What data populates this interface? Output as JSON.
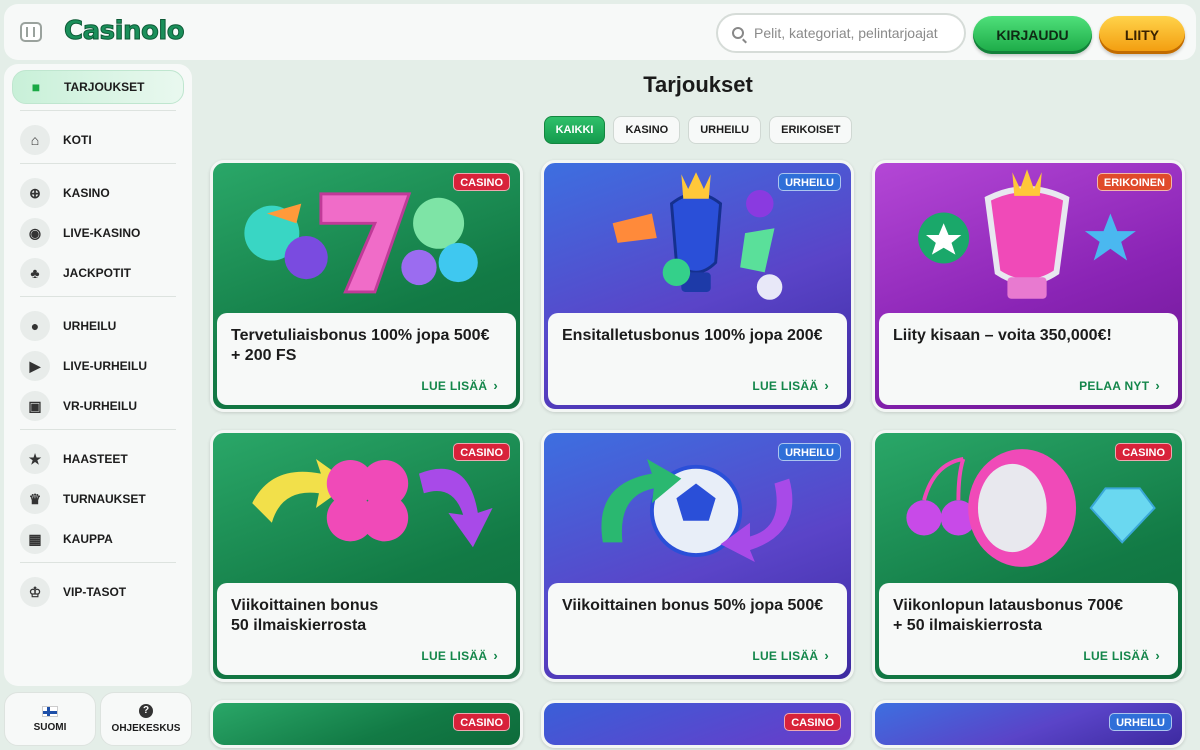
{
  "header": {
    "logo": "Casinolo",
    "search_placeholder": "Pelit, kategoriat, pelintarjoajat",
    "login_label": "KIRJAUDU",
    "join_label": "LIITY"
  },
  "sidebar": {
    "items": [
      {
        "label": "TARJOUKSET",
        "icon": "gift-icon",
        "glyph": "🎁",
        "active": true
      },
      {
        "label": "KOTI",
        "icon": "home-icon",
        "glyph": "⌂"
      },
      {
        "label": "KASINO",
        "icon": "chip-icon",
        "glyph": "⊕"
      },
      {
        "label": "LIVE-KASINO",
        "icon": "live-casino-icon",
        "glyph": "◉"
      },
      {
        "label": "JACKPOTIT",
        "icon": "clubs-icon",
        "glyph": "♣"
      },
      {
        "label": "URHEILU",
        "icon": "soccer-ball-icon",
        "glyph": "⚽"
      },
      {
        "label": "LIVE-URHEILU",
        "icon": "live-tv-icon",
        "glyph": "▶"
      },
      {
        "label": "VR-URHEILU",
        "icon": "vr-tv-icon",
        "glyph": "▣"
      },
      {
        "label": "HAASTEET",
        "icon": "star-badge-icon",
        "glyph": "★"
      },
      {
        "label": "TURNAUKSET",
        "icon": "trophy-icon",
        "glyph": "♛"
      },
      {
        "label": "KAUPPA",
        "icon": "shopping-bag-icon",
        "glyph": "▦"
      },
      {
        "label": "VIP-TASOT",
        "icon": "crown-icon",
        "glyph": "♔"
      }
    ],
    "footer": {
      "language_label": "SUOMI",
      "help_label": "OHJEKESKUS",
      "help_glyph": "?"
    }
  },
  "main": {
    "title": "Tarjoukset",
    "filters": [
      "KAIKKI",
      "KASINO",
      "URHEILU",
      "ERIKOISET"
    ],
    "active_filter": "KAIKKI",
    "cards": [
      {
        "badge": "CASINO",
        "badge_type": "casino",
        "theme": "green",
        "art": "lucky-seven-balloons",
        "title": "Tervetuliaisbonus 100% jopa 500€ + 200 FS",
        "link": "LUE LISÄÄ"
      },
      {
        "badge": "URHEILU",
        "badge_type": "sport",
        "theme": "blue",
        "art": "trophy-balloons",
        "title": "Ensitalletusbonus 100% jopa 200€",
        "link": "LUE LISÄÄ"
      },
      {
        "badge": "ERIKOINEN",
        "badge_type": "special",
        "theme": "purple",
        "art": "medal-trophy-balloons",
        "title": "Liity kisaan – voita 350,000€!",
        "link": "PELAA NYT"
      },
      {
        "badge": "CASINO",
        "badge_type": "casino",
        "theme": "green",
        "art": "clover-arrows-balloons",
        "title": "Viikoittainen bonus\n50 ilmaiskierrosta",
        "link": "LUE LISÄÄ"
      },
      {
        "badge": "URHEILU",
        "badge_type": "sport",
        "theme": "blue",
        "art": "football-arrows-balloons",
        "title": "Viikoittainen bonus 50% jopa 500€",
        "link": "LUE LISÄÄ"
      },
      {
        "badge": "CASINO",
        "badge_type": "casino",
        "theme": "green",
        "art": "cherries-reel-diamond-balloons",
        "title": "Viikonlopun latausbonus 700€\n+ 50 ilmaiskierrosta",
        "link": "LUE LISÄÄ"
      },
      {
        "badge": "CASINO",
        "badge_type": "casino",
        "theme": "green",
        "art": "partial"
      },
      {
        "badge": "CASINO",
        "badge_type": "casino",
        "theme": "blue",
        "art": "partial"
      },
      {
        "badge": "URHEILU",
        "badge_type": "sport",
        "theme": "blue",
        "art": "partial"
      }
    ]
  },
  "colors": {
    "accent_green": "#159b4d",
    "link_green": "#13864a",
    "join_orange": "#f29a0c",
    "casino_badge": "#d8223a",
    "sport_badge": "#2f6fd8",
    "special_badge": "#e04a2a"
  }
}
